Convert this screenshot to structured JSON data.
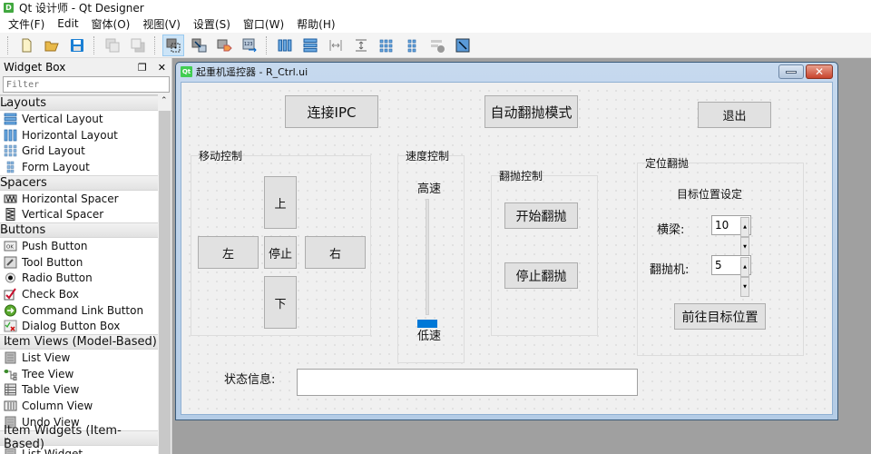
{
  "app": {
    "icon_letter": "D",
    "title": "Qt 设计师 - Qt Designer"
  },
  "menubar": {
    "items": [
      "文件(F)",
      "Edit",
      "窗体(O)",
      "视图(V)",
      "设置(S)",
      "窗口(W)",
      "帮助(H)"
    ]
  },
  "toolbar": {
    "groups": [
      [
        "new-file-icon",
        "open-folder-icon",
        "save-icon"
      ],
      [
        "bring-to-front-icon",
        "send-to-back-icon"
      ],
      [
        "edit-widgets-icon",
        "edit-signals-slots-icon",
        "edit-buddies-icon",
        "edit-tab-order-icon"
      ],
      [
        "horizontal-layout-icon",
        "vertical-layout-icon",
        "horizontal-splitter-icon",
        "vertical-splitter-icon",
        "grid-layout-icon",
        "form-layout-icon",
        "break-layout-icon",
        "adjust-size-icon"
      ]
    ],
    "active": "edit-widgets-icon"
  },
  "widget_box": {
    "title": "Widget Box",
    "filter_placeholder": "Filter",
    "categories": [
      {
        "label": "Layouts",
        "items": [
          {
            "label": "Vertical Layout",
            "icon": "vertical-layout-icon"
          },
          {
            "label": "Horizontal Layout",
            "icon": "horizontal-layout-icon"
          },
          {
            "label": "Grid Layout",
            "icon": "grid-layout-icon"
          },
          {
            "label": "Form Layout",
            "icon": "form-layout-icon"
          }
        ]
      },
      {
        "label": "Spacers",
        "items": [
          {
            "label": "Horizontal Spacer",
            "icon": "horizontal-spacer-icon"
          },
          {
            "label": "Vertical Spacer",
            "icon": "vertical-spacer-icon"
          }
        ]
      },
      {
        "label": "Buttons",
        "items": [
          {
            "label": "Push Button",
            "icon": "push-button-icon"
          },
          {
            "label": "Tool Button",
            "icon": "tool-button-icon"
          },
          {
            "label": "Radio Button",
            "icon": "radio-button-icon"
          },
          {
            "label": "Check Box",
            "icon": "check-box-icon"
          },
          {
            "label": "Command Link Button",
            "icon": "command-link-icon"
          },
          {
            "label": "Dialog Button Box",
            "icon": "dialog-button-box-icon"
          }
        ]
      },
      {
        "label": "Item Views (Model-Based)",
        "items": [
          {
            "label": "List View",
            "icon": "list-view-icon"
          },
          {
            "label": "Tree View",
            "icon": "tree-view-icon"
          },
          {
            "label": "Table View",
            "icon": "table-view-icon"
          },
          {
            "label": "Column View",
            "icon": "column-view-icon"
          },
          {
            "label": "Undo View",
            "icon": "undo-view-icon"
          }
        ]
      },
      {
        "label": "Item Widgets (Item-Based)",
        "items": [
          {
            "label": "List Widget",
            "icon": "list-widget-icon"
          }
        ]
      }
    ]
  },
  "form_window": {
    "icon_label": "Qt",
    "title": "起重机遥控器 - R_Ctrl.ui",
    "buttons": {
      "connect": "连接IPC",
      "auto_mode": "自动翻抛模式",
      "exit": "退出"
    },
    "move_group": {
      "title": "移动控制",
      "up": "上",
      "left": "左",
      "stop": "停止",
      "right": "右",
      "down": "下"
    },
    "speed_group": {
      "title": "速度控制",
      "high_label": "高速",
      "low_label": "低速",
      "slider_value_fraction": 0.0
    },
    "flip_group": {
      "title": "翻抛控制",
      "start": "开始翻抛",
      "stop": "停止翻抛"
    },
    "position_group": {
      "title": "定位翻抛",
      "subtitle": "目标位置设定",
      "beam_label": "横梁:",
      "beam_value": "10",
      "flipper_label": "翻抛机:",
      "flipper_value": "5",
      "go_button": "前往目标位置"
    },
    "status": {
      "label": "状态信息:",
      "value": ""
    }
  }
}
